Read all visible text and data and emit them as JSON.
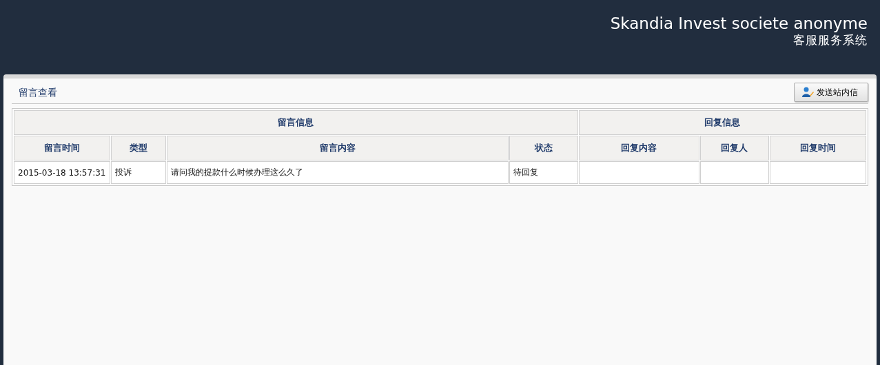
{
  "header": {
    "company": "Skandia Invest societe anonyme",
    "system": "客服服务系统"
  },
  "section": {
    "title": "留言查看",
    "button": "发送站内信"
  },
  "table": {
    "groups": [
      {
        "label": "留言信息",
        "columns": [
          "留言时间",
          "类型",
          "留言内容",
          "状态"
        ]
      },
      {
        "label": "回复信息",
        "columns": [
          "回复内容",
          "回复人",
          "回复时间"
        ]
      }
    ],
    "rows": [
      {
        "cells": [
          "2015-03-18 13:57:31",
          "投诉",
          "请问我的提款什么时候办理这么久了",
          "待回复",
          "",
          "",
          ""
        ]
      }
    ]
  }
}
